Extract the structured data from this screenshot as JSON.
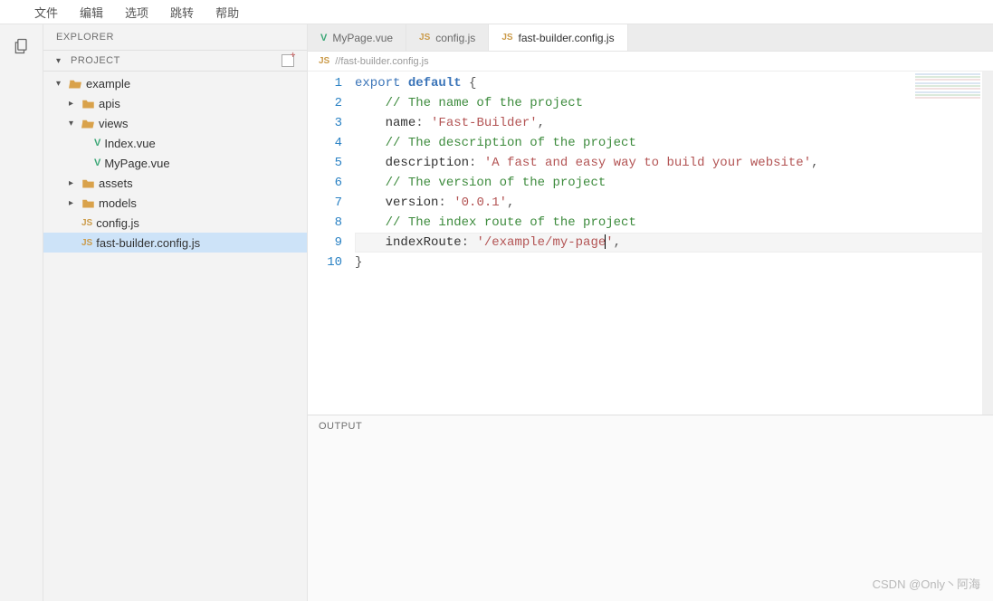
{
  "menu": [
    "文件",
    "编辑",
    "选项",
    "跳转",
    "帮助"
  ],
  "sidebar": {
    "explorer_label": "EXPLORER",
    "project_label": "PROJECT"
  },
  "tree": [
    {
      "name": "example",
      "type": "folder-open",
      "depth": 0,
      "expanded": true
    },
    {
      "name": "apis",
      "type": "folder",
      "depth": 1,
      "expanded": false
    },
    {
      "name": "views",
      "type": "folder-open",
      "depth": 1,
      "expanded": true
    },
    {
      "name": "Index.vue",
      "type": "vue",
      "depth": 2
    },
    {
      "name": "MyPage.vue",
      "type": "vue",
      "depth": 2
    },
    {
      "name": "assets",
      "type": "folder",
      "depth": 1,
      "expanded": false
    },
    {
      "name": "models",
      "type": "folder",
      "depth": 1,
      "expanded": false
    },
    {
      "name": "config.js",
      "type": "js",
      "depth": 1
    },
    {
      "name": "fast-builder.config.js",
      "type": "js",
      "depth": 1,
      "selected": true
    }
  ],
  "tabs": [
    {
      "label": "MyPage.vue",
      "icon": "vue",
      "active": false
    },
    {
      "label": "config.js",
      "icon": "js",
      "active": false
    },
    {
      "label": "fast-builder.config.js",
      "icon": "js",
      "active": true
    }
  ],
  "breadcrumb": {
    "icon": "js",
    "path": "//fast-builder.config.js"
  },
  "code": {
    "lines": [
      [
        {
          "t": "export ",
          "c": "kw"
        },
        {
          "t": "default ",
          "c": "def"
        },
        {
          "t": "{",
          "c": "pun"
        }
      ],
      [
        {
          "t": "    ",
          "c": ""
        },
        {
          "t": "// The name of the project",
          "c": "com"
        }
      ],
      [
        {
          "t": "    ",
          "c": ""
        },
        {
          "t": "name",
          "c": "prop"
        },
        {
          "t": ": ",
          "c": "pun"
        },
        {
          "t": "'Fast-Builder'",
          "c": "str"
        },
        {
          "t": ",",
          "c": "pun"
        }
      ],
      [
        {
          "t": "    ",
          "c": ""
        },
        {
          "t": "// The description of the project",
          "c": "com"
        }
      ],
      [
        {
          "t": "    ",
          "c": ""
        },
        {
          "t": "description",
          "c": "prop"
        },
        {
          "t": ": ",
          "c": "pun"
        },
        {
          "t": "'A fast and easy way to build your website'",
          "c": "str"
        },
        {
          "t": ",",
          "c": "pun"
        }
      ],
      [
        {
          "t": "    ",
          "c": ""
        },
        {
          "t": "// The version of the project",
          "c": "com"
        }
      ],
      [
        {
          "t": "    ",
          "c": ""
        },
        {
          "t": "version",
          "c": "prop"
        },
        {
          "t": ": ",
          "c": "pun"
        },
        {
          "t": "'0.0.1'",
          "c": "str"
        },
        {
          "t": ",",
          "c": "pun"
        }
      ],
      [
        {
          "t": "    ",
          "c": ""
        },
        {
          "t": "// The index route of the project",
          "c": "com"
        }
      ],
      [
        {
          "t": "    ",
          "c": ""
        },
        {
          "t": "indexRoute",
          "c": "prop"
        },
        {
          "t": ": ",
          "c": "pun"
        },
        {
          "t": "'/example/my-page",
          "c": "str"
        },
        {
          "t": "",
          "cursor": true
        },
        {
          "t": "'",
          "c": "str"
        },
        {
          "t": ",",
          "c": "pun"
        }
      ],
      [
        {
          "t": "}",
          "c": "pun"
        }
      ]
    ],
    "current_line_index": 8
  },
  "output": {
    "label": "OUTPUT"
  },
  "watermark": "CSDN @Only丶阿海"
}
